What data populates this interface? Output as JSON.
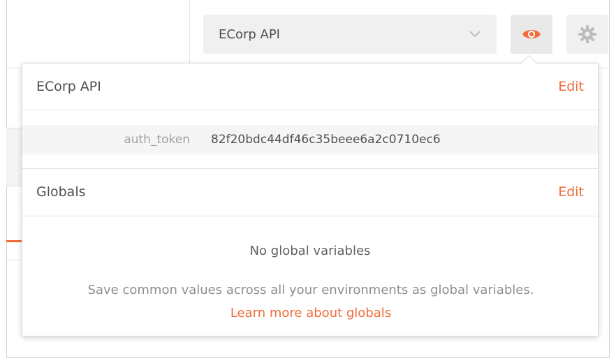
{
  "header": {
    "environment_selected": "ECorp API",
    "chevron_icon": "chevron-down-icon",
    "eye_icon": "eye-icon",
    "gear_icon": "gear-icon",
    "accent_color": "#f26b3a"
  },
  "popover": {
    "environment": {
      "title": "ECorp API",
      "edit_label": "Edit",
      "variables": [
        {
          "key": "auth_token",
          "value": "82f20bdc44df46c35beee6a2c0710ec6"
        }
      ]
    },
    "globals": {
      "title": "Globals",
      "edit_label": "Edit",
      "empty_title": "No global variables",
      "empty_desc": "Save common values across all your environments as global variables.",
      "learn_more_label": "Learn more about globals"
    }
  }
}
